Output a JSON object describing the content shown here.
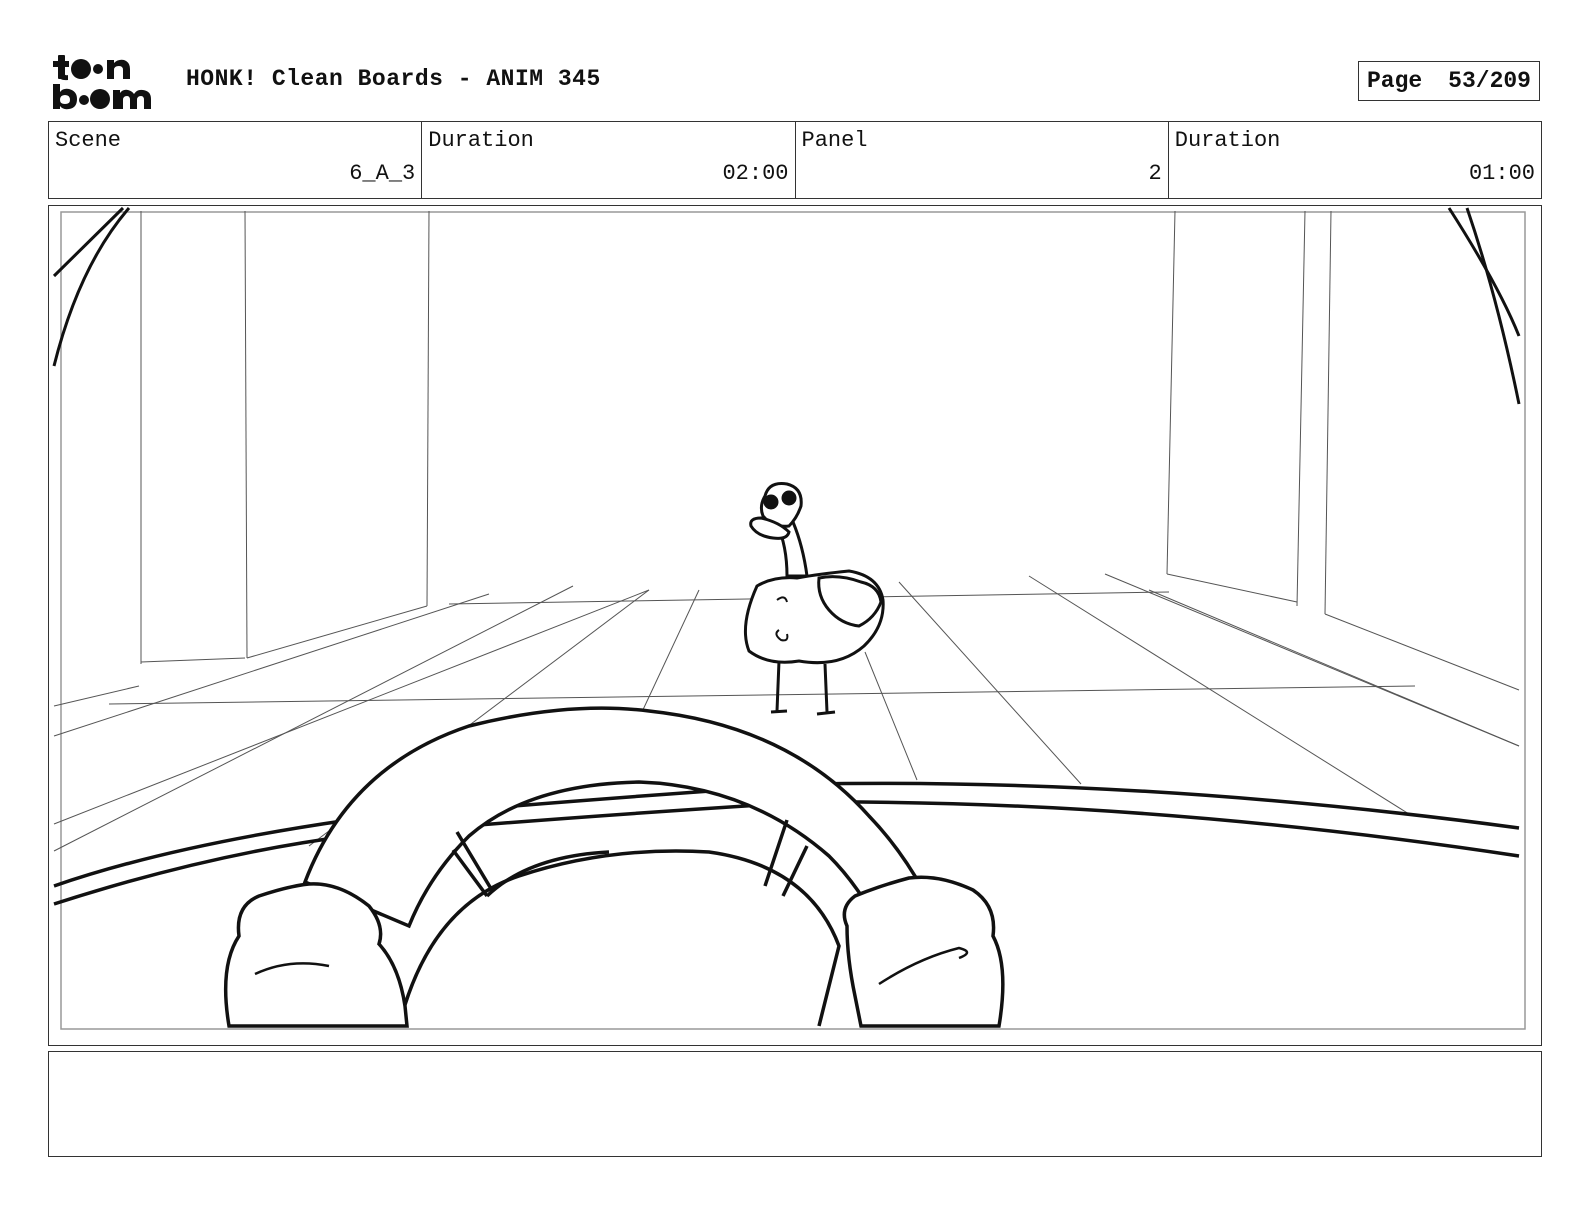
{
  "header": {
    "logo_text": "toon boom",
    "title": "HONK! Clean Boards - ANIM 345",
    "page_label": "Page",
    "page_value": "53/209"
  },
  "info": {
    "scene_label": "Scene",
    "scene_value": "6_A_3",
    "scene_duration_label": "Duration",
    "scene_duration_value": "02:00",
    "panel_label": "Panel",
    "panel_value": "2",
    "panel_duration_label": "Duration",
    "panel_duration_value": "01:00"
  },
  "notes": {
    "text": ""
  }
}
